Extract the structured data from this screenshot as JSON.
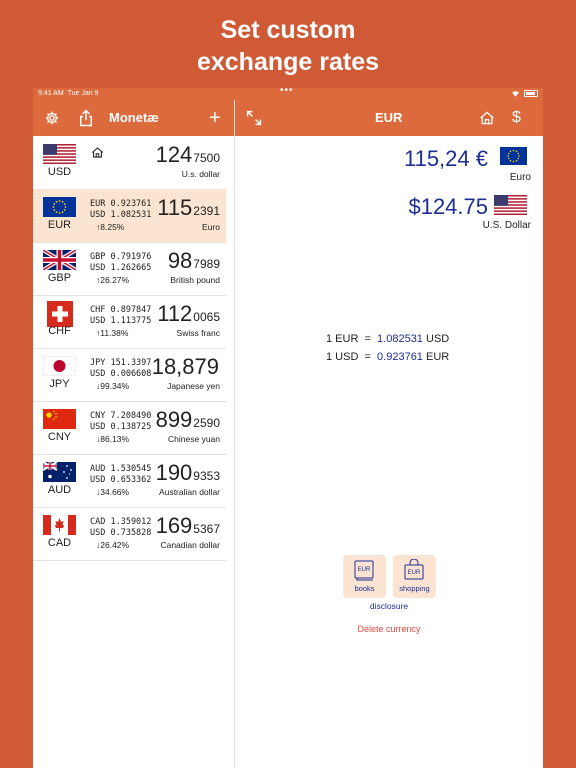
{
  "promo": {
    "line1": "Set custom",
    "line2": "exchange rates"
  },
  "status": {
    "time": "9:41 AM",
    "date": "Tue Jan 9",
    "dots": "•••"
  },
  "left_nav": {
    "title": "Monetæ"
  },
  "right_nav": {
    "title": "EUR"
  },
  "currencies": [
    {
      "code": "USD",
      "amount_main": "124",
      "amount_dec": "7500",
      "name": "U.s. dollar",
      "rate1": "",
      "rate2": "",
      "change": "",
      "flag": "us-flag"
    },
    {
      "code": "EUR",
      "amount_main": "115",
      "amount_dec": "2391",
      "name": "Euro",
      "rate1": "EUR 0.923761",
      "rate2": "USD 1.082531",
      "change": "↑8.25%",
      "flag": "eu-flag"
    },
    {
      "code": "GBP",
      "amount_main": "98",
      "amount_dec": "7989",
      "name": "British pound",
      "rate1": "GBP 0.791976",
      "rate2": "USD 1.262665",
      "change": "↑26.27%",
      "flag": "uk-flag"
    },
    {
      "code": "CHF",
      "amount_main": "112",
      "amount_dec": "0065",
      "name": "Swiss franc",
      "rate1": "CHF 0.897847",
      "rate2": "USD 1.113775",
      "change": "↑11.38%",
      "flag": "swiss-flag"
    },
    {
      "code": "JPY",
      "amount_main": "18,879",
      "amount_dec": "",
      "name": "Japanese yen",
      "rate1": "JPY 151.3397",
      "rate2": "USD 0.006608",
      "change": "↓99.34%",
      "flag": "japan-flag"
    },
    {
      "code": "CNY",
      "amount_main": "899",
      "amount_dec": "2590",
      "name": "Chinese yuan",
      "rate1": "CNY 7.208490",
      "rate2": "USD 0.138725",
      "change": "↓86.13%",
      "flag": "china-flag"
    },
    {
      "code": "AUD",
      "amount_main": "190",
      "amount_dec": "9353",
      "name": "Australian dollar",
      "rate1": "AUD 1.530545",
      "rate2": "USD 0.653362",
      "change": "↓34.66%",
      "flag": "australia-flag"
    },
    {
      "code": "CAD",
      "amount_main": "169",
      "amount_dec": "5367",
      "name": "Canadian dollar",
      "rate1": "CAD 1.359012",
      "rate2": "USD 0.735828",
      "change": "↓26.42%",
      "flag": "canada-flag"
    }
  ],
  "detail": {
    "primary_value": "115,24 €",
    "primary_name": "Euro",
    "secondary_value": "$124.75",
    "secondary_name": "U.S. Dollar",
    "conv1_left": "1 EUR  =  ",
    "conv1_value": "1.082531",
    "conv1_unit": " USD",
    "conv2_left": "1 USD  =  ",
    "conv2_value": "0.923761",
    "conv2_unit": " EUR",
    "tile_books": "books",
    "tile_shopping": "shopping",
    "tile_icon_text": "EUR",
    "disclosure": "disclosure",
    "delete": "Delete currency"
  },
  "colors": {
    "background": "#cf5a35",
    "bar": "#dd6a3d",
    "selected": "#fbe4d1",
    "value_blue": "#1c2e95",
    "delete_red": "#e04a3f"
  }
}
